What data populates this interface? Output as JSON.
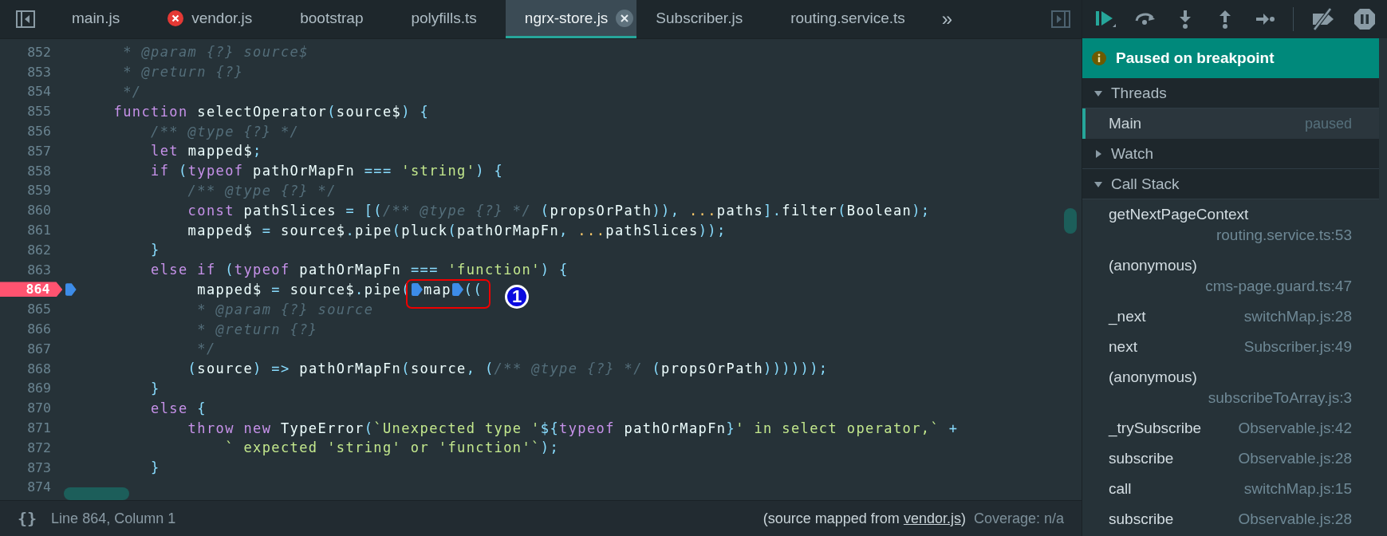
{
  "tabs": [
    {
      "label": "main.js",
      "selected": false,
      "error": false
    },
    {
      "label": "vendor.js",
      "selected": false,
      "error": true
    },
    {
      "label": "bootstrap",
      "selected": false,
      "error": false
    },
    {
      "label": "polyfills.ts",
      "selected": false,
      "error": false
    },
    {
      "label": "ngrx-store.js",
      "selected": true,
      "error": false
    },
    {
      "label": "Subscriber.js",
      "selected": false,
      "error": false
    },
    {
      "label": "routing.service.ts",
      "selected": false,
      "error": false
    }
  ],
  "more_tabs": "»",
  "code": [
    {
      "number": "852",
      "breakpoint": false,
      "tokens": [
        {
          "kind": "c",
          "text": "     * @param {?} source$"
        }
      ]
    },
    {
      "number": "853",
      "breakpoint": false,
      "tokens": [
        {
          "kind": "c",
          "text": "     * @return {?}"
        }
      ]
    },
    {
      "number": "854",
      "breakpoint": false,
      "tokens": [
        {
          "kind": "c",
          "text": "     */"
        }
      ]
    },
    {
      "number": "855",
      "breakpoint": false,
      "tokens": [
        {
          "kind": "k",
          "text": "    function "
        },
        {
          "kind": "i",
          "text": "selectOperator"
        },
        {
          "kind": "p",
          "text": "("
        },
        {
          "kind": "i",
          "text": "source$"
        },
        {
          "kind": "p",
          "text": ") {"
        }
      ]
    },
    {
      "number": "856",
      "breakpoint": false,
      "tokens": [
        {
          "kind": "c",
          "text": "        /** @type {?} */"
        }
      ]
    },
    {
      "number": "857",
      "breakpoint": false,
      "tokens": [
        {
          "kind": "k",
          "text": "        let "
        },
        {
          "kind": "i",
          "text": "mapped$"
        },
        {
          "kind": "p",
          "text": ";"
        }
      ]
    },
    {
      "number": "858",
      "breakpoint": false,
      "tokens": [
        {
          "kind": "k",
          "text": "        if "
        },
        {
          "kind": "p",
          "text": "("
        },
        {
          "kind": "k",
          "text": "typeof "
        },
        {
          "kind": "i",
          "text": "pathOrMapFn "
        },
        {
          "kind": "p",
          "text": "=== "
        },
        {
          "kind": "s",
          "text": "'string'"
        },
        {
          "kind": "p",
          "text": ") {"
        }
      ]
    },
    {
      "number": "859",
      "breakpoint": false,
      "tokens": [
        {
          "kind": "c",
          "text": "            /** @type {?} */"
        }
      ]
    },
    {
      "number": "860",
      "breakpoint": false,
      "tokens": [
        {
          "kind": "k",
          "text": "            const "
        },
        {
          "kind": "i",
          "text": "pathSlices "
        },
        {
          "kind": "p",
          "text": "= [("
        },
        {
          "kind": "c",
          "text": "/** @type {?} */ "
        },
        {
          "kind": "p",
          "text": "("
        },
        {
          "kind": "i",
          "text": "propsOrPath"
        },
        {
          "kind": "p",
          "text": ")), "
        },
        {
          "kind": "y",
          "text": "..."
        },
        {
          "kind": "i",
          "text": "paths"
        },
        {
          "kind": "p",
          "text": "]."
        },
        {
          "kind": "i",
          "text": "filter"
        },
        {
          "kind": "p",
          "text": "("
        },
        {
          "kind": "i",
          "text": "Boolean"
        },
        {
          "kind": "p",
          "text": ");"
        }
      ]
    },
    {
      "number": "861",
      "breakpoint": false,
      "tokens": [
        {
          "kind": "i",
          "text": "            mapped$ "
        },
        {
          "kind": "p",
          "text": "= "
        },
        {
          "kind": "i",
          "text": "source$"
        },
        {
          "kind": "p",
          "text": "."
        },
        {
          "kind": "i",
          "text": "pipe"
        },
        {
          "kind": "p",
          "text": "("
        },
        {
          "kind": "i",
          "text": "pluck"
        },
        {
          "kind": "p",
          "text": "("
        },
        {
          "kind": "i",
          "text": "pathOrMapFn"
        },
        {
          "kind": "p",
          "text": ", "
        },
        {
          "kind": "y",
          "text": "..."
        },
        {
          "kind": "i",
          "text": "pathSlices"
        },
        {
          "kind": "p",
          "text": "));"
        }
      ]
    },
    {
      "number": "862",
      "breakpoint": false,
      "tokens": [
        {
          "kind": "p",
          "text": "        }"
        }
      ]
    },
    {
      "number": "863",
      "breakpoint": false,
      "tokens": [
        {
          "kind": "k",
          "text": "        else if "
        },
        {
          "kind": "p",
          "text": "("
        },
        {
          "kind": "k",
          "text": "typeof "
        },
        {
          "kind": "i",
          "text": "pathOrMapFn "
        },
        {
          "kind": "p",
          "text": "=== "
        },
        {
          "kind": "s",
          "text": "'function'"
        },
        {
          "kind": "p",
          "text": ") {"
        }
      ]
    },
    {
      "number": "864",
      "breakpoint": true,
      "annotation": "1",
      "tokens": [
        {
          "kind": "i",
          "text": "             mapped$ "
        },
        {
          "kind": "p",
          "text": "= "
        },
        {
          "kind": "i",
          "text": "source$"
        },
        {
          "kind": "p",
          "text": "."
        },
        {
          "kind": "i",
          "text": "pipe"
        },
        {
          "kind": "p",
          "text": "("
        },
        {
          "kind": "marker"
        },
        {
          "kind": "i",
          "text": "map"
        },
        {
          "kind": "marker"
        },
        {
          "kind": "p",
          "text": "(("
        }
      ]
    },
    {
      "number": "865",
      "breakpoint": false,
      "tokens": [
        {
          "kind": "c",
          "text": "             * @param {?} source"
        }
      ]
    },
    {
      "number": "866",
      "breakpoint": false,
      "tokens": [
        {
          "kind": "c",
          "text": "             * @return {?}"
        }
      ]
    },
    {
      "number": "867",
      "breakpoint": false,
      "tokens": [
        {
          "kind": "c",
          "text": "             */"
        }
      ]
    },
    {
      "number": "868",
      "breakpoint": false,
      "tokens": [
        {
          "kind": "p",
          "text": "            ("
        },
        {
          "kind": "i",
          "text": "source"
        },
        {
          "kind": "p",
          "text": ") => "
        },
        {
          "kind": "i",
          "text": "pathOrMapFn"
        },
        {
          "kind": "p",
          "text": "("
        },
        {
          "kind": "i",
          "text": "source"
        },
        {
          "kind": "p",
          "text": ", ("
        },
        {
          "kind": "c",
          "text": "/** @type {?} */ "
        },
        {
          "kind": "p",
          "text": "("
        },
        {
          "kind": "i",
          "text": "propsOrPath"
        },
        {
          "kind": "p",
          "text": "))))));"
        }
      ]
    },
    {
      "number": "869",
      "breakpoint": false,
      "tokens": [
        {
          "kind": "p",
          "text": "        }"
        }
      ]
    },
    {
      "number": "870",
      "breakpoint": false,
      "tokens": [
        {
          "kind": "k",
          "text": "        else "
        },
        {
          "kind": "p",
          "text": "{"
        }
      ]
    },
    {
      "number": "871",
      "breakpoint": false,
      "tokens": [
        {
          "kind": "k",
          "text": "            throw new "
        },
        {
          "kind": "i",
          "text": "TypeError"
        },
        {
          "kind": "p",
          "text": "("
        },
        {
          "kind": "s",
          "text": "`Unexpected type '"
        },
        {
          "kind": "p",
          "text": "${"
        },
        {
          "kind": "k",
          "text": "typeof "
        },
        {
          "kind": "i",
          "text": "pathOrMapFn"
        },
        {
          "kind": "p",
          "text": "}"
        },
        {
          "kind": "s",
          "text": "' in select operator,` "
        },
        {
          "kind": "p",
          "text": "+"
        }
      ]
    },
    {
      "number": "872",
      "breakpoint": false,
      "tokens": [
        {
          "kind": "s",
          "text": "                ` expected 'string' or 'function'`"
        },
        {
          "kind": "p",
          "text": ");"
        }
      ]
    },
    {
      "number": "873",
      "breakpoint": false,
      "tokens": [
        {
          "kind": "p",
          "text": "        }"
        }
      ]
    },
    {
      "number": "874",
      "breakpoint": false
    }
  ],
  "status_bar": {
    "pretty_print": "{}",
    "position": "Line 864, Column 1",
    "source_prefix": "(source mapped from ",
    "source_link": "vendor.js",
    "source_suffix": ")",
    "coverage": "Coverage: n/a"
  },
  "debugger": {
    "banner": "Paused on breakpoint",
    "sections": [
      {
        "title": "Threads",
        "expanded": true,
        "kind": "threads",
        "items": [
          {
            "name": "Main",
            "status": "paused",
            "selected": true
          }
        ]
      },
      {
        "title": "Watch",
        "expanded": false
      },
      {
        "title": "Call Stack",
        "expanded": true,
        "kind": "stack",
        "items": [
          {
            "name": "getNextPageContext",
            "location": "routing.service.ts:53"
          },
          {
            "name": "(anonymous)",
            "location": "cms-page.guard.ts:47"
          },
          {
            "name": "_next",
            "location": "switchMap.js:28"
          },
          {
            "name": "next",
            "location": "Subscriber.js:49"
          },
          {
            "name": "(anonymous)",
            "location": "subscribeToArray.js:3"
          },
          {
            "name": "_trySubscribe",
            "location": "Observable.js:42"
          },
          {
            "name": "subscribe",
            "location": "Observable.js:28"
          },
          {
            "name": "call",
            "location": "switchMap.js:15"
          },
          {
            "name": "subscribe",
            "location": "Observable.js:28"
          }
        ]
      }
    ]
  }
}
